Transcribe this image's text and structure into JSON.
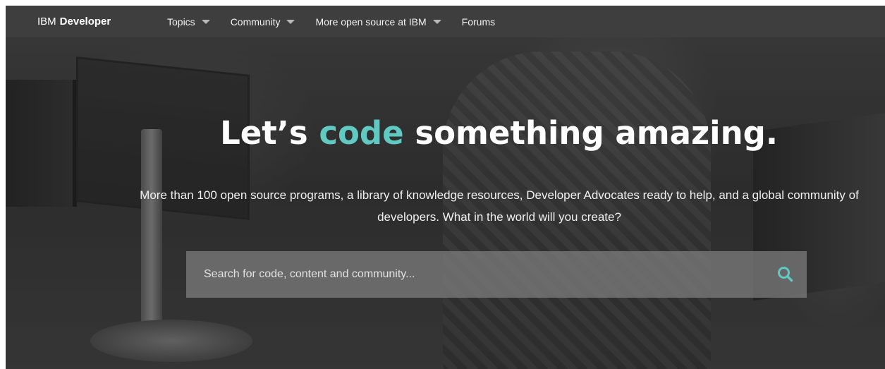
{
  "nav": {
    "brand_prefix": "IBM",
    "brand_name": "Developer",
    "items": [
      {
        "label": "Topics",
        "has_dropdown": true
      },
      {
        "label": "Community",
        "has_dropdown": true
      },
      {
        "label": "More open source at IBM",
        "has_dropdown": true
      },
      {
        "label": "Forums",
        "has_dropdown": false
      }
    ]
  },
  "hero": {
    "headline_before": "Let’s ",
    "headline_accent": "code",
    "headline_after": " something amazing.",
    "subheading": "More than 100 open source programs, a library of knowledge resources, Developer Advocates ready to help, and a global community of developers. What in the world will you create?"
  },
  "search": {
    "placeholder": "Search for code, content and community...",
    "value": "",
    "icon": "search-icon"
  },
  "colors": {
    "accent": "#5fc9c2",
    "nav_background": "#3e3e3e",
    "search_background": "#808080"
  }
}
